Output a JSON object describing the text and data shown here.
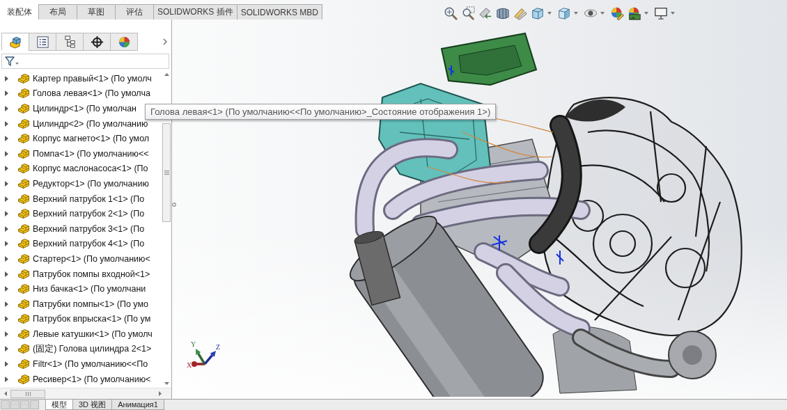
{
  "command_tabs": [
    {
      "label": "装配体",
      "selected": true
    },
    {
      "label": "布局",
      "selected": false
    },
    {
      "label": "草图",
      "selected": false
    },
    {
      "label": "评估",
      "selected": false
    },
    {
      "label": "SOLIDWORKS 插件",
      "selected": false
    },
    {
      "label": "SOLIDWORKS MBD",
      "selected": false
    }
  ],
  "view_toolbar": [
    {
      "kind": "zoom-fit",
      "dropdown": false
    },
    {
      "kind": "zoom-area",
      "dropdown": false
    },
    {
      "kind": "previous-view",
      "dropdown": false
    },
    {
      "kind": "section",
      "dropdown": false
    },
    {
      "kind": "annotation",
      "dropdown": false
    },
    {
      "kind": "orientation",
      "dropdown": true
    },
    {
      "kind": "display-style",
      "dropdown": true
    },
    {
      "kind": "hide-show",
      "dropdown": true
    },
    {
      "kind": "appearance",
      "dropdown": false
    },
    {
      "kind": "scene",
      "dropdown": true
    },
    {
      "kind": "settings",
      "dropdown": true
    }
  ],
  "panel_tabs": [
    {
      "kind": "features",
      "selected": true
    },
    {
      "kind": "properties",
      "selected": false
    },
    {
      "kind": "configurations",
      "selected": false
    },
    {
      "kind": "dimxpert",
      "selected": false
    },
    {
      "kind": "display",
      "selected": false
    }
  ],
  "feature_tree": {
    "items": [
      {
        "label": "Картер правый<1> (По умолч",
        "expanded": false
      },
      {
        "label": "Голова левая<1> (По умолча",
        "expanded": false
      },
      {
        "label": "Цилиндр<1> (По умолчан",
        "expanded": false
      },
      {
        "label": "Цилиндр<2> (По умолчанию",
        "expanded": false
      },
      {
        "label": "Корпус магнето<1> (По умол",
        "expanded": false
      },
      {
        "label": "Помпа<1> (По умолчанию<<",
        "expanded": false
      },
      {
        "label": "Корпус маслонасоса<1> (По",
        "expanded": false
      },
      {
        "label": "Редуктор<1> (По умолчанию",
        "expanded": false
      },
      {
        "label": "Верхний патрубок 1<1> (По",
        "expanded": false
      },
      {
        "label": "Верхний патрубок 2<1> (По",
        "expanded": false
      },
      {
        "label": "Верхний патрубок 3<1> (По",
        "expanded": false
      },
      {
        "label": "Верхний патрубок 4<1> (По",
        "expanded": false
      },
      {
        "label": "Стартер<1> (По умолчанию<",
        "expanded": false
      },
      {
        "label": "Патрубок помпы входной<1>",
        "expanded": false
      },
      {
        "label": "Низ бачка<1> (По умолчани",
        "expanded": false
      },
      {
        "label": "Патрубки помпы<1> (По умо",
        "expanded": false
      },
      {
        "label": "Патрубок впрыска<1> (По ум",
        "expanded": false
      },
      {
        "label": "Левые катушки<1> (По умолч",
        "expanded": false
      },
      {
        "label": "(固定) Голова цилиндра 2<1>",
        "expanded": false
      },
      {
        "label": "Filtr<1> (По умолчанию<<По",
        "expanded": false
      },
      {
        "label": "Ресивер<1> (По умолчанию<",
        "expanded": false
      }
    ]
  },
  "tooltip": {
    "text": "Голова левая<1> (По умолчанию<<По умолчанию>_Состояние отображения 1>)"
  },
  "triad": {
    "axes": [
      {
        "kind": "x",
        "label": "X"
      },
      {
        "kind": "y",
        "label": "Y"
      },
      {
        "kind": "z",
        "label": "Z"
      }
    ]
  },
  "bottom_tabs": [
    {
      "label": "模型",
      "selected": true
    },
    {
      "label": "3D 视图",
      "selected": false
    },
    {
      "label": "Анимация1",
      "selected": false
    }
  ]
}
